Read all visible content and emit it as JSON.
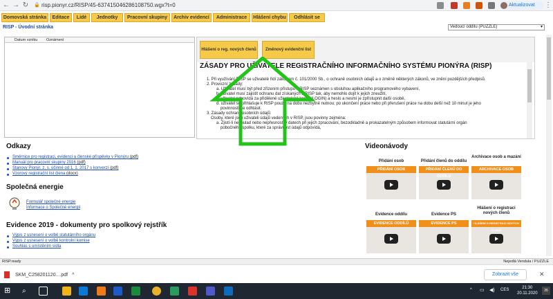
{
  "browser": {
    "url": "risp.pionyr.cz/RISP/45-637415046286108750.wgx?t=0",
    "update_label": "Aktualizovat"
  },
  "menu": {
    "items": [
      "Domovská stránka",
      "Editace",
      "Lidé",
      "Jednotky",
      "Pracovní skupiny",
      "Archiv evidencí",
      "Administrace",
      "Hlášení chybu",
      "Odhlásit se"
    ]
  },
  "page": {
    "title": "RISP - Úvodní stránka",
    "unit_select": "Vedoucí oddílu (PUZZLE)"
  },
  "notifications": {
    "col_date": "Datum vzniku",
    "col_notice": "Oznámení"
  },
  "panel": {
    "btn_report": "Hlášení o reg. nových členů",
    "btn_changes": "Změnový evidenční list",
    "rules_title": "ZÁSADY PRO UŽIVATELE REGISTRAČNÍHO INFORMAČNÍHO SYSTÉMU PIONÝRA (RISP)",
    "rules": [
      "1. Při využívání RISP se uživatelé řídí zákonem č. 101/2000 Sb., o ochraně osobních údajů a o změně některých zákonů, ve znění pozdějších předpisů.",
      "2. Provozní zásady:",
      "a. Uživatel musí být před zřízením přístupu k RISP seznámen s obsluhou aplikačního programového vybavení,",
      "b. uživatel musí zajistit ochranu dat získaných z RISP tak, aby nemohlo dojít k jejich zneužití,",
      "c. uživatel odpovídá za přidělené uživatelské konto (LOGIN) a heslo a nesmí je zpřístupnit další osobě,",
      "d. uživatel se přihlašuje k RISP pouze na dobu nezbytně nutnou; po ukončení práce nebo při přerušení práce na dobu delší než 10 minut je jeho",
      "povinností se odhlásit.",
      "3. Zásady ochrany osobních údajů:",
      "Osoby, které jsou uživateli údajů vedených v RISP, jsou povinny zejména:",
      "a. Zjistí-li nesoulad nebo nepřesnosti v datech při jejich zpracování, bezodkladně a prokazatelným způsobem informovat statutární orgán",
      "pobočného spolku, které za správnost údajů odpovídá,"
    ]
  },
  "links": {
    "title": "Odkazy",
    "items": [
      {
        "text": "Směrnice pro registraci, evidenci a členské příspěvky v Pionýru",
        "suffix": " (pdf)"
      },
      {
        "text": "Manuál pro pracovní skupiny 2016",
        "suffix": " (pdf)"
      },
      {
        "text": "Stanovy Pionýr, z. s. účinné od 1. 1. 2017 s konverzí",
        "suffix": " (pdf)"
      },
      {
        "text": "Vzorový registrační list člena",
        "suffix": " (docx)"
      }
    ]
  },
  "energy": {
    "title": "Společná energie",
    "items": [
      "Formulář společné energie",
      "Informace o Společné energii"
    ]
  },
  "evidence": {
    "title": "Evidence 2019 - dokumenty pro spolkový rejstřík",
    "items": [
      "Výpis z usnesení o volbě statutárního orgánu",
      "Výpis z usnesení o volbě kontrolní komise",
      "Souhlas s umístěním sídla"
    ]
  },
  "videos": {
    "title": "Videonávody",
    "items": [
      {
        "caption": "Přidání osob",
        "band": "PŘIDÁNÍ OSOB"
      },
      {
        "caption": "Přidání členů do oddílu",
        "band": "PŘIDÁNÍ ČLENŮ DO ODDÍLU"
      },
      {
        "caption": "Archivace osob a mazání",
        "band": "ARCHIVACE OSOB"
      },
      {
        "caption": "Evidence oddílu",
        "band": "EVIDENCE ODDÍLŮ"
      },
      {
        "caption": "Evidence PS",
        "band": "EVIDENCE PS"
      },
      {
        "caption": "Hlášení o registraci nových členů",
        "band": "HLÁŠENÍ O REGISTRACI NOVÝCH ČLENŮ"
      }
    ]
  },
  "status": {
    "left": "RISP.ready",
    "right": "Nejedlá Vendula / PUZZLE"
  },
  "download": {
    "file": "SKM_C258201120....pdf",
    "show_all": "Zobrazit vše"
  },
  "taskbar": {
    "lang": "CES",
    "time": "21:30",
    "date": "20.11.2020",
    "notif_count": "26"
  },
  "colors": {
    "menu_yellow": "#f7c948",
    "link_blue": "#1a4dab",
    "arrow_green": "#22c41a",
    "video_orange": "#f18f1b"
  }
}
